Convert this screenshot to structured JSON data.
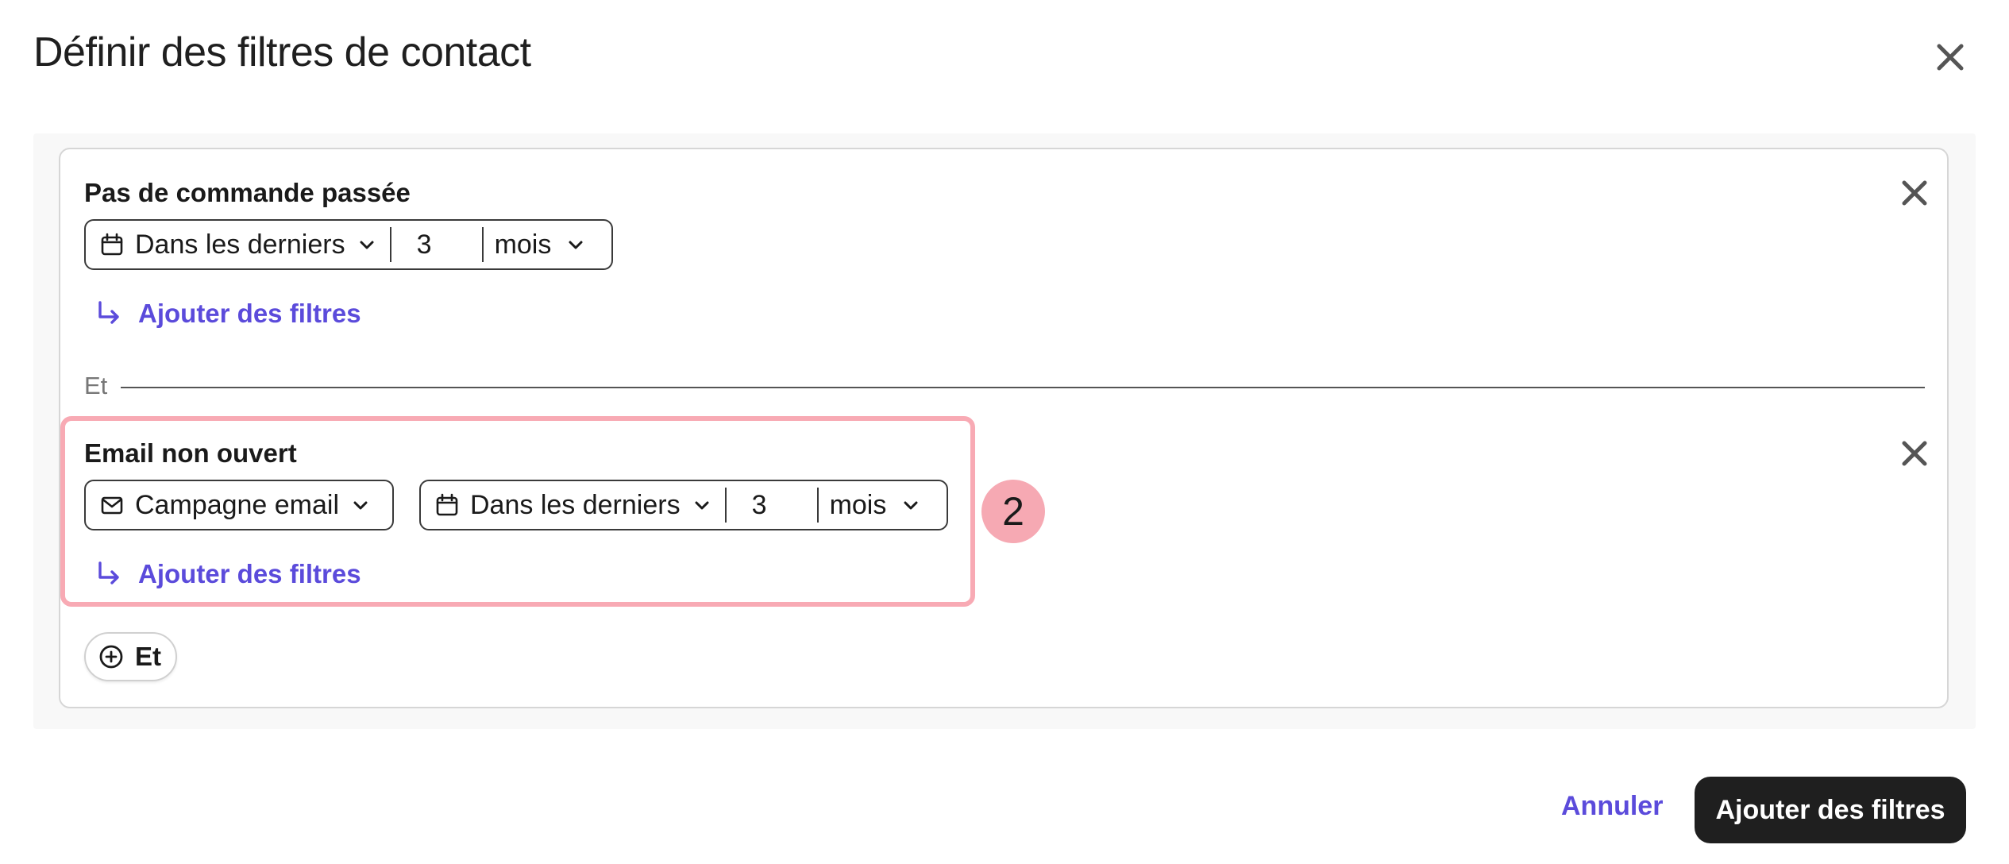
{
  "modal": {
    "title": "Définir des filtres de contact"
  },
  "groups": [
    {
      "title": "Pas de commande passée",
      "period_label": "Dans les derniers",
      "quantity": "3",
      "unit": "mois",
      "add_filters_label": "Ajouter des filtres"
    },
    {
      "title": "Email non ouvert",
      "source_label": "Campagne email",
      "period_label": "Dans les derniers",
      "quantity": "3",
      "unit": "mois",
      "add_filters_label": "Ajouter des filtres"
    }
  ],
  "connector": {
    "label": "Et"
  },
  "add_and_button": {
    "label": "Et"
  },
  "step_badge": {
    "number": "2"
  },
  "footer": {
    "cancel_label": "Annuler",
    "submit_label": "Ajouter des filtres"
  },
  "colors": {
    "accent": "#5b4bdb",
    "highlight": "#f8aab4",
    "badge": "#f6a9b3",
    "primary_button": "#1f1f1f"
  }
}
